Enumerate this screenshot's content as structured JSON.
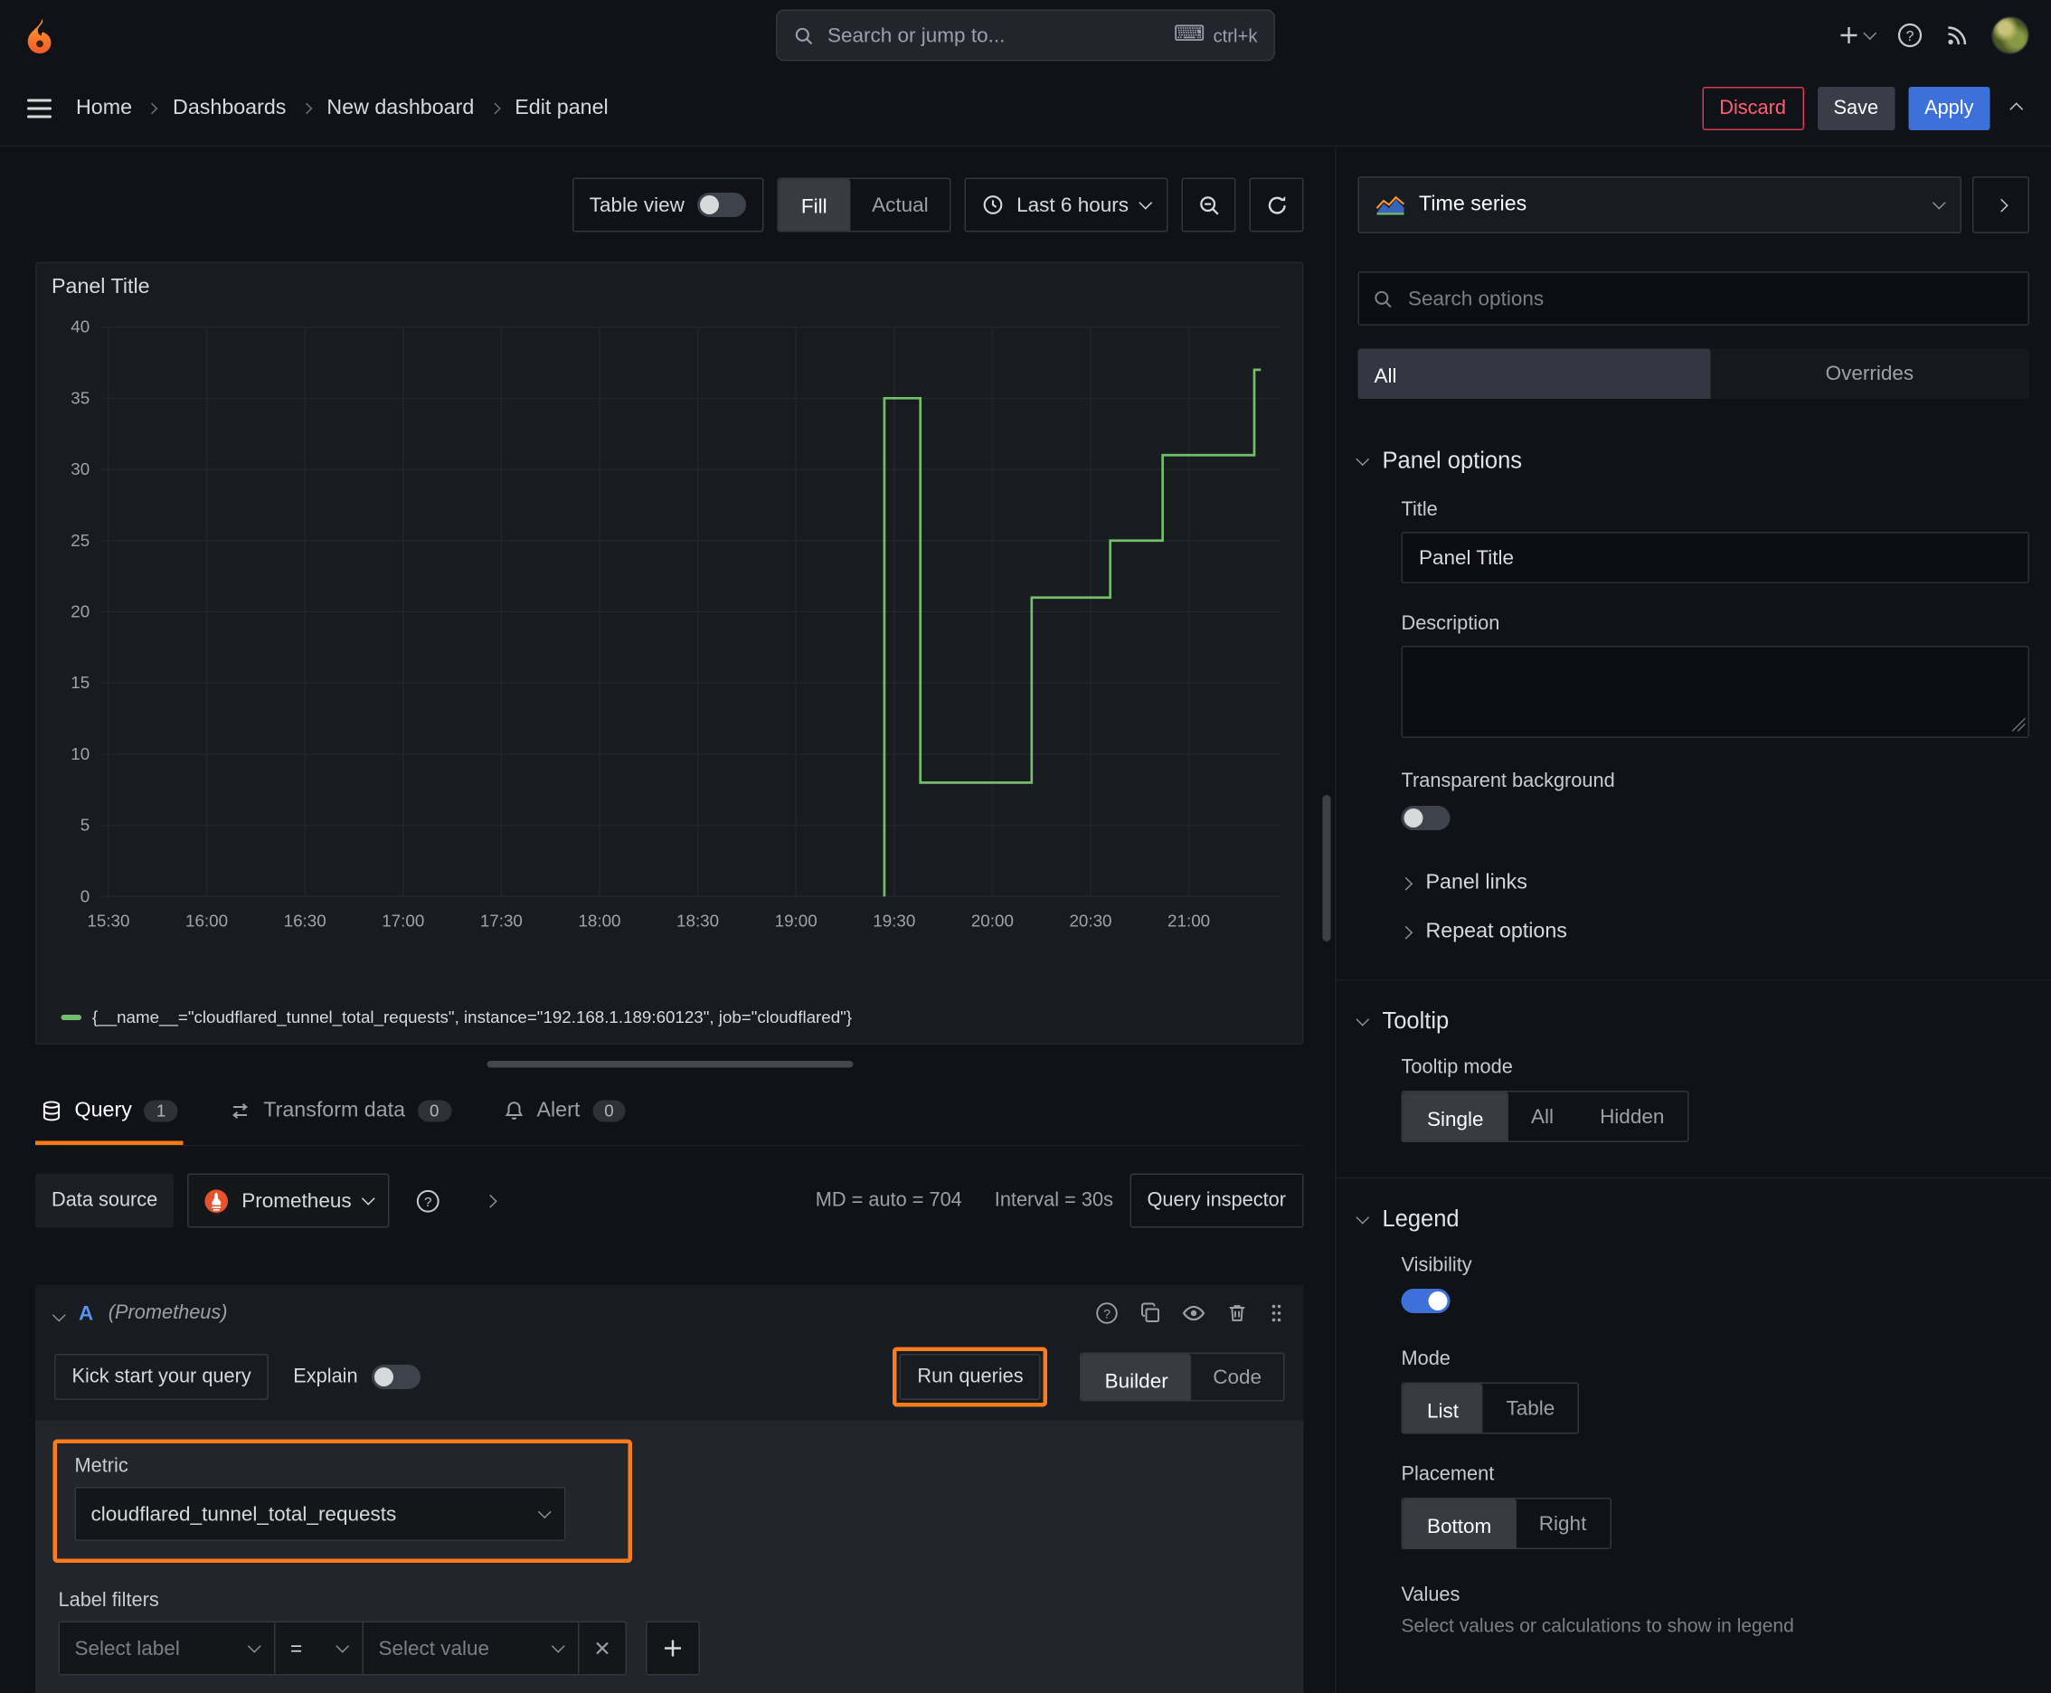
{
  "topbar": {
    "search_placeholder": "Search or jump to...",
    "search_shortcut": "ctrl+k"
  },
  "breadcrumb": {
    "items": [
      "Home",
      "Dashboards",
      "New dashboard",
      "Edit panel"
    ]
  },
  "nav_actions": {
    "discard": "Discard",
    "save": "Save",
    "apply": "Apply"
  },
  "viz_toolbar": {
    "table_view": "Table view",
    "fill": "Fill",
    "actual": "Actual",
    "time_range": "Last 6 hours"
  },
  "panel": {
    "title": "Panel Title"
  },
  "chart_data": {
    "type": "line",
    "step": true,
    "title": "Panel Title",
    "x_ticks": [
      "15:30",
      "16:00",
      "16:30",
      "17:00",
      "17:30",
      "18:00",
      "18:30",
      "19:00",
      "19:30",
      "20:00",
      "20:30",
      "21:00"
    ],
    "y_ticks": [
      0,
      5,
      10,
      15,
      20,
      25,
      30,
      35,
      40
    ],
    "ylim": [
      0,
      40
    ],
    "xlim_minutes": [
      928,
      1288
    ],
    "line_color": "#73bf69",
    "grid_color": "#23252b",
    "tick_color": "#a0a3ab",
    "legend_position": "bottom",
    "series": [
      {
        "name": "{__name__=\"cloudflared_tunnel_total_requests\", instance=\"192.168.1.189:60123\", job=\"cloudflared\"}",
        "points": [
          [
            "19:27",
            0
          ],
          [
            "19:27",
            35
          ],
          [
            "19:38",
            35
          ],
          [
            "19:38",
            8
          ],
          [
            "20:12",
            8
          ],
          [
            "20:12",
            21
          ],
          [
            "20:36",
            21
          ],
          [
            "20:36",
            25
          ],
          [
            "20:52",
            25
          ],
          [
            "20:52",
            31
          ],
          [
            "21:20",
            31
          ],
          [
            "21:20",
            37
          ],
          [
            "21:22",
            37
          ]
        ]
      }
    ]
  },
  "tabs": {
    "items": [
      {
        "label": "Query",
        "count": "1"
      },
      {
        "label": "Transform data",
        "count": "0"
      },
      {
        "label": "Alert",
        "count": "0"
      }
    ]
  },
  "datasource": {
    "label": "Data source",
    "name": "Prometheus",
    "stats_md": "MD = auto = 704",
    "stats_interval": "Interval = 30s",
    "query_inspector": "Query inspector"
  },
  "query": {
    "ref_id": "A",
    "ds_hint": "(Prometheus)",
    "kick_start": "Kick start your query",
    "explain": "Explain",
    "run_queries": "Run queries",
    "builder": "Builder",
    "code": "Code",
    "metric_label": "Metric",
    "metric_value": "cloudflared_tunnel_total_requests",
    "label_filters": "Label filters",
    "select_label": "Select label",
    "operator": "=",
    "select_value": "Select value"
  },
  "options": {
    "viz_name": "Time series",
    "search_placeholder": "Search options",
    "tab_all": "All",
    "tab_overrides": "Overrides",
    "panel_options": {
      "title": "Panel options",
      "title_label": "Title",
      "title_value": "Panel Title",
      "description_label": "Description",
      "transparent": "Transparent background",
      "panel_links": "Panel links",
      "repeat_options": "Repeat options"
    },
    "tooltip": {
      "title": "Tooltip",
      "mode_label": "Tooltip mode",
      "single": "Single",
      "all": "All",
      "hidden": "Hidden"
    },
    "legend": {
      "title": "Legend",
      "visibility": "Visibility",
      "mode_label": "Mode",
      "list": "List",
      "table": "Table",
      "placement_label": "Placement",
      "bottom": "Bottom",
      "right": "Right",
      "values_label": "Values",
      "values_hint": "Select values or calculations to show in legend"
    }
  },
  "colors": {
    "accent_orange": "#ff780a",
    "primary_blue": "#3d71d9",
    "series_green": "#73bf69",
    "destructive_red": "#e02f44",
    "annotation_orange": "#ff7a1a"
  },
  "icons": {
    "grafana-logo": "flame",
    "search-icon": "magnifier",
    "keyboard-icon": "⌨",
    "add-icon": "+",
    "help-icon": "?",
    "news-icon": "rss",
    "menu-icon": "hamburger",
    "clock-icon": "clock",
    "zoom-out-icon": "magnifier-minus",
    "refresh-icon": "circular-arrows",
    "database-icon": "cylinder",
    "transform-icon": "swap-arrows",
    "bell-icon": "bell",
    "copy-icon": "duplicate",
    "eye-icon": "eye",
    "trash-icon": "trash",
    "grip-icon": "six-dots",
    "close-icon": "x",
    "prometheus-icon": "torch",
    "timeseries-icon": "mini-area-chart"
  }
}
